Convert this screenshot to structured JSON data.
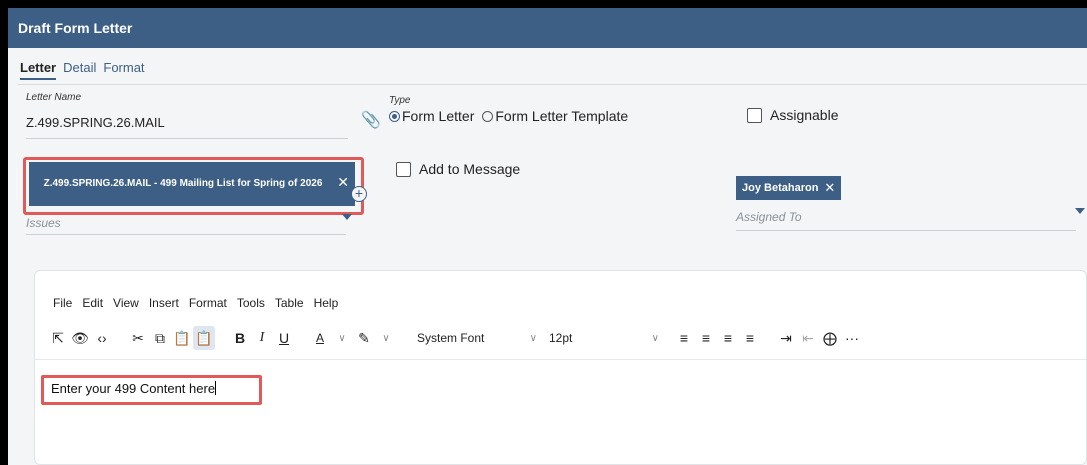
{
  "window": {
    "title": "Draft Form Letter"
  },
  "tabs": [
    {
      "label": "Letter",
      "active": true
    },
    {
      "label": "Detail",
      "active": false
    },
    {
      "label": "Format",
      "active": false
    }
  ],
  "letter_name": {
    "label": "Letter Name",
    "value": "Z.499.SPRING.26.MAIL"
  },
  "type": {
    "label": "Type",
    "options": [
      {
        "label": "Form Letter",
        "checked": true
      },
      {
        "label": "Form Letter Template",
        "checked": false
      }
    ]
  },
  "assignable": {
    "label": "Assignable",
    "checked": false
  },
  "add_to_message": {
    "label": "Add to Message",
    "checked": false
  },
  "issues": {
    "chip": "Z.499.SPRING.26.MAIL - 499 Mailing List for Spring of 2026",
    "placeholder": "Issues"
  },
  "assigned_to": {
    "chip": "Joy Betaharon",
    "placeholder": "Assigned To"
  },
  "editor": {
    "menu": [
      "File",
      "Edit",
      "View",
      "Insert",
      "Format",
      "Tools",
      "Table",
      "Help"
    ],
    "font_family": "System Font",
    "font_size": "12pt",
    "content": "Enter your 499 Content here"
  },
  "colors": {
    "header": "#3d5f85",
    "highlight": "#e05a5a"
  }
}
